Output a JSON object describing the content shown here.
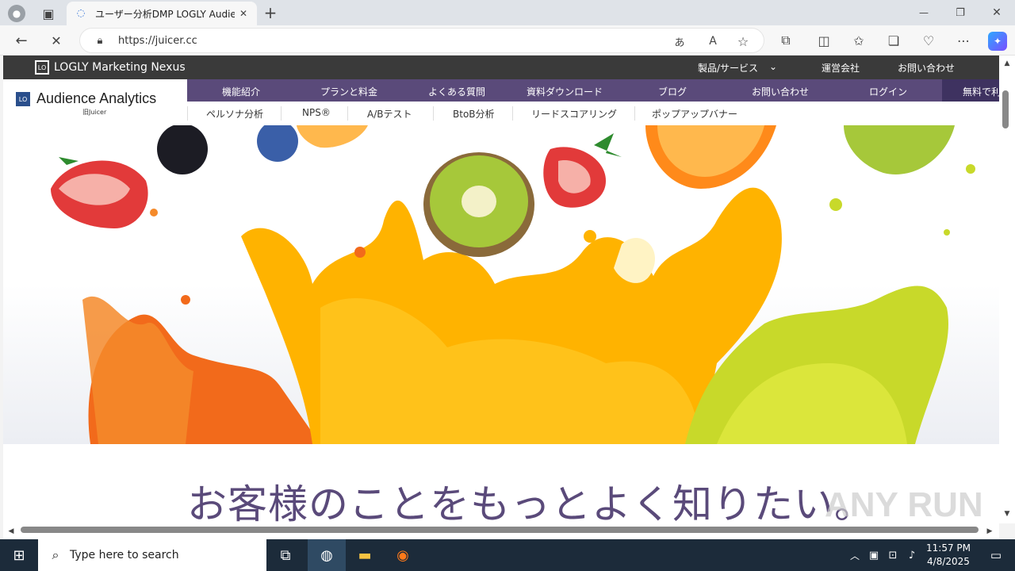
{
  "browser": {
    "tab_title": "ユーザー分析DMP LOGLY Audience",
    "url": "https://juicer.cc",
    "new_tab": "+",
    "minimize": "—",
    "restore": "❐",
    "close": "✕"
  },
  "site": {
    "topbar": {
      "brand": "LOGLY Marketing Nexus",
      "brand_mark": "LO",
      "products": "製品/サービス",
      "company": "運営会社",
      "contact": "お問い合わせ"
    },
    "logo": {
      "mark": "LO",
      "name": "Audience Analytics",
      "sub": "旧Juicer"
    },
    "main_nav": [
      "機能紹介",
      "プランと料金",
      "よくある質問",
      "資料ダウンロード",
      "ブログ",
      "お問い合わせ",
      "ログイン"
    ],
    "main_nav_cta": "無料で利",
    "sub_nav": [
      "ペルソナ分析",
      "NPS®",
      "A/Bテスト",
      "BtoB分析",
      "リードスコアリング",
      "ポップアップバナー"
    ],
    "tagline": "お客様のことをもっとよく知りたい。",
    "watermark": "ANY RUN"
  },
  "taskbar": {
    "search_placeholder": "Type here to search",
    "time": "11:57 PM",
    "date": "4/8/2025"
  },
  "colors": {
    "nav_purple": "#5a4a7a",
    "topbar_dark": "#3a3a3a",
    "taskbar": "#1c2b3a"
  }
}
